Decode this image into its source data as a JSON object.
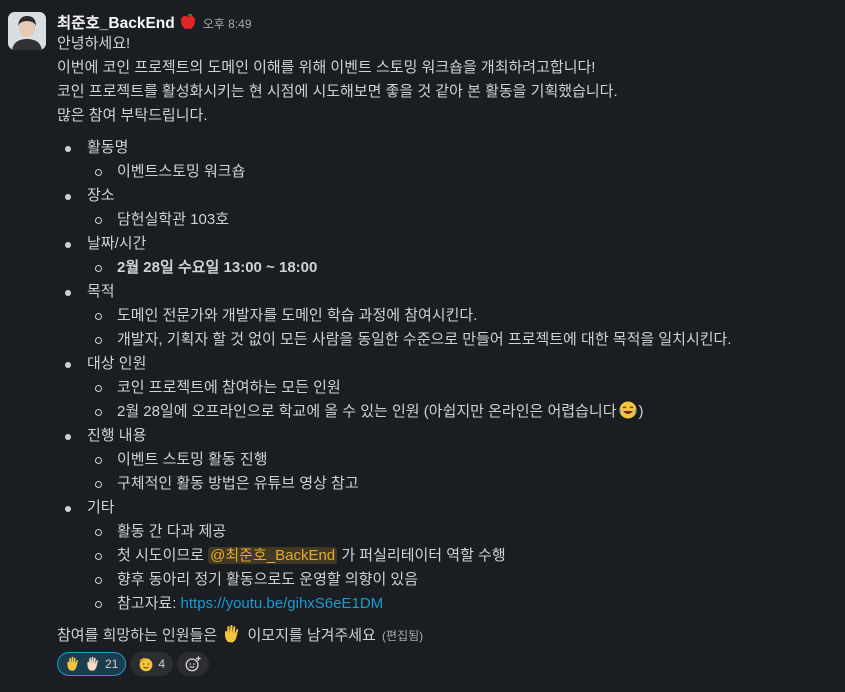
{
  "message": {
    "sender": "최준호_BackEnd",
    "sender_badge_icon": "red-apple-icon",
    "time": "오후 8:49",
    "intro_lines": [
      "안녕하세요!",
      "이번에 코인 프로젝트의 도메인 이해를 위해 이벤트 스토밍 워크숍을 개최하려고합니다!",
      "코인 프로젝트를 활성화시키는 현 시점에 시도해보면 좋을 것 같아 본 활동을 기획했습니다.",
      "많은 참여 부탁드립니다."
    ],
    "sections": [
      {
        "title": "활동명",
        "items": [
          "이벤트스토밍 워크숍"
        ]
      },
      {
        "title": "장소",
        "items": [
          "담헌실학관 103호"
        ]
      },
      {
        "title": "날짜/시간",
        "items": [
          "2월 28일 수요일 13:00 ~ 18:00"
        ]
      },
      {
        "title": "목적",
        "items": [
          "도메인 전문가와 개발자를 도메인 학습 과정에 참여시킨다.",
          "개발자, 기획자 할 것 없이 모든 사람을 동일한 수준으로 만들어 프로젝트에 대한 목적을 일치시킨다."
        ]
      },
      {
        "title": "대상 인원",
        "items": [
          "코인 프로젝트에 참여하는 모든 인원",
          "2월 28일에 오프라인으로 학교에 올 수 있는 인원 (아쉽지만 온라인은 어렵습니다",
          ")"
        ]
      },
      {
        "title": "진행 내용",
        "items": [
          "이벤트 스토밍 활동 진행",
          "구체적인 활동 방법은 유튜브 영상 참고"
        ]
      },
      {
        "title": "기타",
        "items": [
          "활동 간 다과 제공",
          "첫 시도이므로",
          "@최준호_BackEnd",
          "가 퍼실리테이터 역할 수행",
          "향후 동아리 정기 활동으로도 운영할 의향이 있음",
          "참고자료:",
          "https://youtu.be/gihxS6eE1DM"
        ]
      }
    ],
    "closing_before": "참여를 희망하는 인원들은",
    "closing_after": "이모지를 남겨주세요",
    "edited_label": "(편집됨)",
    "reactions": [
      {
        "emoji": "raised-hand-icon",
        "count": "21",
        "active": true
      },
      {
        "emoji": "salute-face-icon",
        "count": "4",
        "active": false
      }
    ]
  }
}
